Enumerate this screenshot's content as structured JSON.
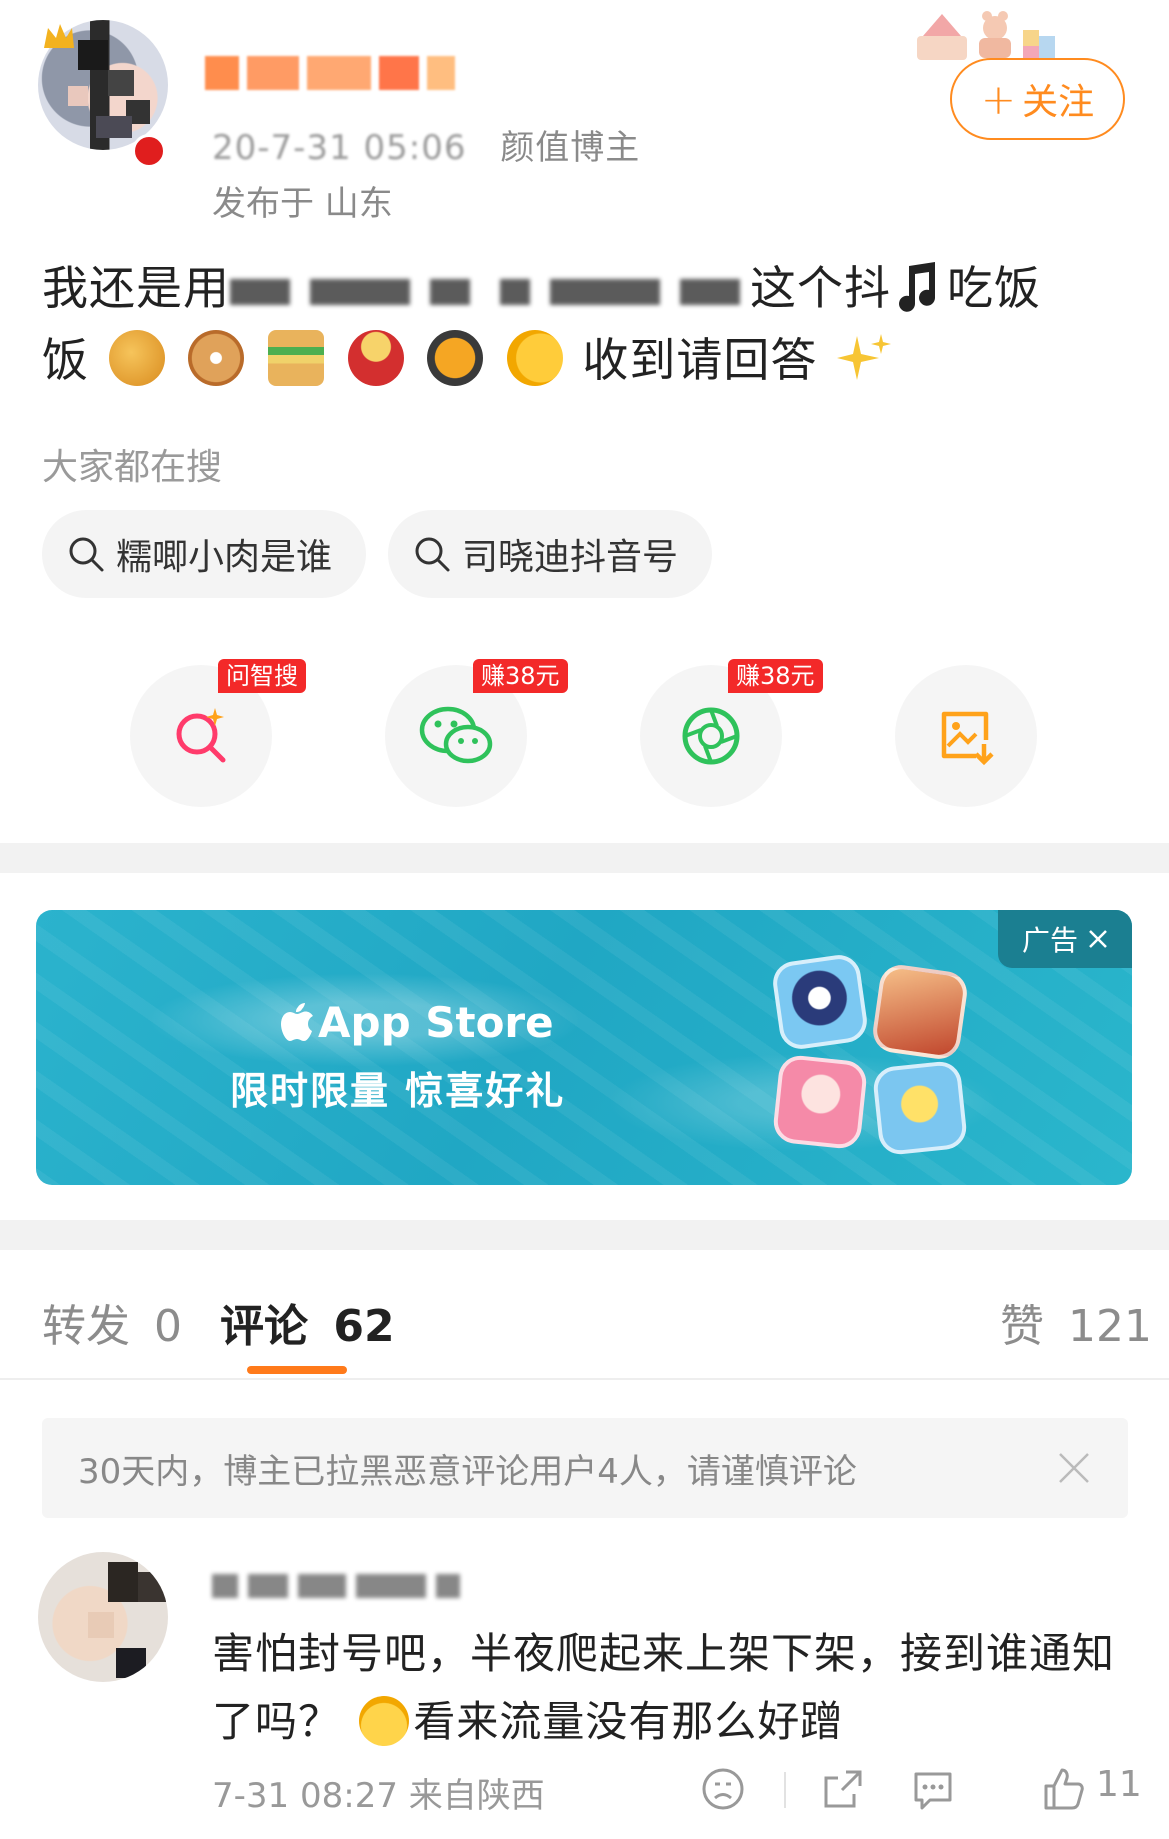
{
  "header": {
    "username": "",
    "time": "20-7-31 05:06",
    "role": "颜值博主",
    "location": "发布于 山东",
    "follow_label": "关注",
    "follow_plus": "+"
  },
  "post": {
    "text_start": "我还是用",
    "text_middle": "这个抖",
    "text_line2_a": "吃饭",
    "text_line2_b": "饭",
    "text_end": "收到请回答",
    "emojis": [
      "croissant-emoji",
      "bagel-emoji",
      "sandwich-emoji",
      "fondue-emoji",
      "paella-emoji",
      "pointing-emoji",
      "sparkles-emoji"
    ]
  },
  "search": {
    "title": "大家都在搜",
    "chips": [
      "糯唧小肉是谁",
      "司晓迪抖音号"
    ]
  },
  "share": {
    "badges": [
      "问智搜",
      "赚38元",
      "赚38元"
    ],
    "colors": {
      "ai": "#ff3b6b",
      "wechat": "#2fc25b",
      "moments": "#2fc25b",
      "save": "#ffa21a"
    }
  },
  "ad": {
    "store": "App Store",
    "slogan": "限时限量 惊喜好礼",
    "tag": "广告"
  },
  "tabs": {
    "repost_label": "转发",
    "repost_count": "0",
    "comment_label": "评论",
    "comment_count": "62",
    "like_label": "赞",
    "like_count": "121"
  },
  "notice": {
    "text": "30天内，博主已拉黑恶意评论用户4人，请谨慎评论"
  },
  "comment": {
    "text_a": "害怕封号吧，半夜爬起来上架下架，接到谁通知了吗？",
    "text_b": "看来流量没有那么好蹭",
    "meta": "7-31 08:27 来自陕西",
    "likes": "11"
  },
  "colors": {
    "accent": "#ff7a1a",
    "badge": "#f32929"
  }
}
